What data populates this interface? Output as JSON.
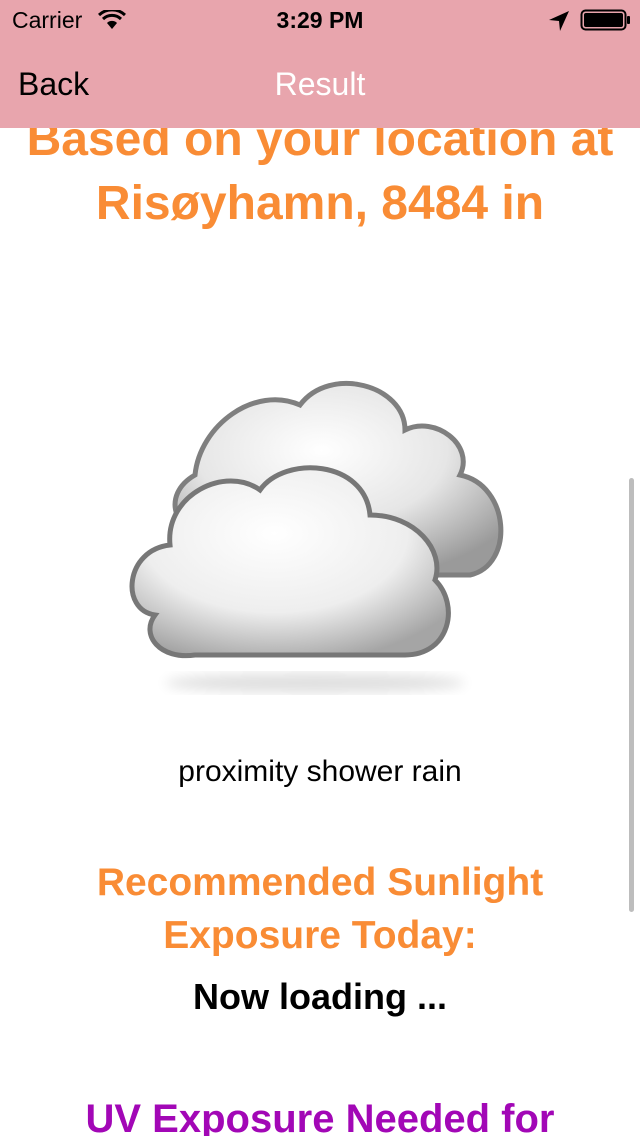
{
  "status_bar": {
    "carrier": "Carrier",
    "time": "3:29 PM",
    "icons": [
      "wifi-icon",
      "location-arrow-icon",
      "battery-icon"
    ]
  },
  "nav": {
    "back_label": "Back",
    "title": "Result",
    "bar_color": "#e8a5ad"
  },
  "main": {
    "location_heading": "Based on your location at Risøyhamn, 8484 in",
    "weather_icon": "cloud-icon",
    "weather_description": "proximity shower rain",
    "recommended_heading": "Recommended Sunlight Exposure Today:",
    "loading_text": "Now loading ...",
    "uv_heading": "UV Exposure Needed for"
  },
  "colors": {
    "accent_orange": "#f98c35",
    "uv_purple": "#a207b6"
  }
}
